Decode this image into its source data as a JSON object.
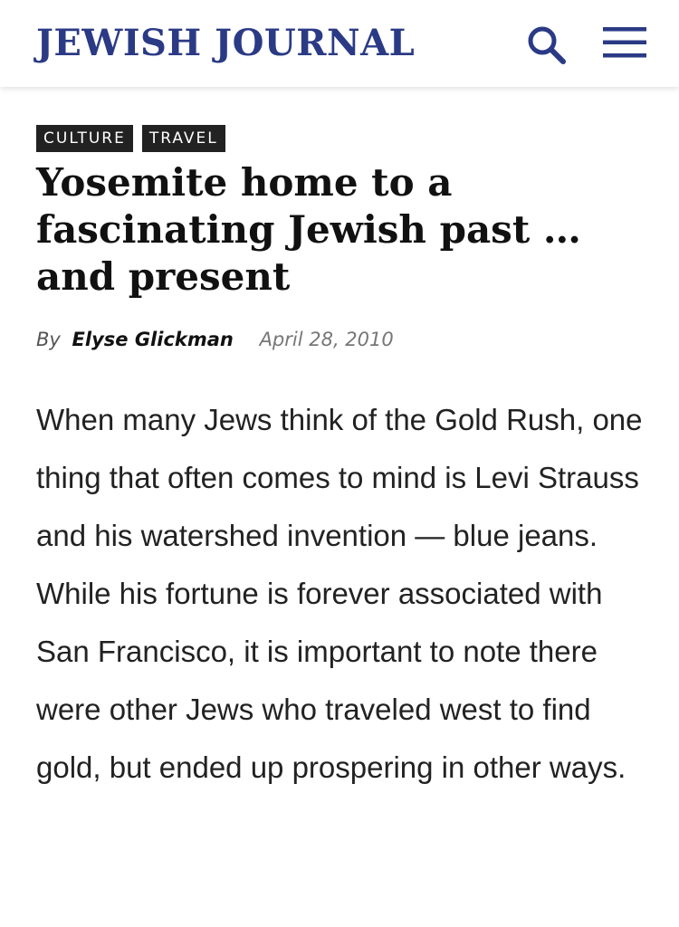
{
  "header": {
    "logo_text": "JEWISH JOURNAL",
    "search_icon": "search-icon",
    "menu_icon": "hamburger-menu-icon",
    "brand_color": "#2a3a85"
  },
  "article": {
    "tags": [
      "CULTURE",
      "TRAVEL"
    ],
    "title": "Yosemite home to a fascinating Jewish past … and present",
    "byline_prefix": "By",
    "author": "Elyse Glickman",
    "date": "April 28, 2010",
    "body": "When many Jews think of the Gold Rush, one thing that often comes to mind is Levi Strauss and his watershed invention — blue jeans. While his fortune is forever associated with San Francisco, it is important to note there were other Jews who traveled west to find gold, but ended up prospering in other ways."
  }
}
